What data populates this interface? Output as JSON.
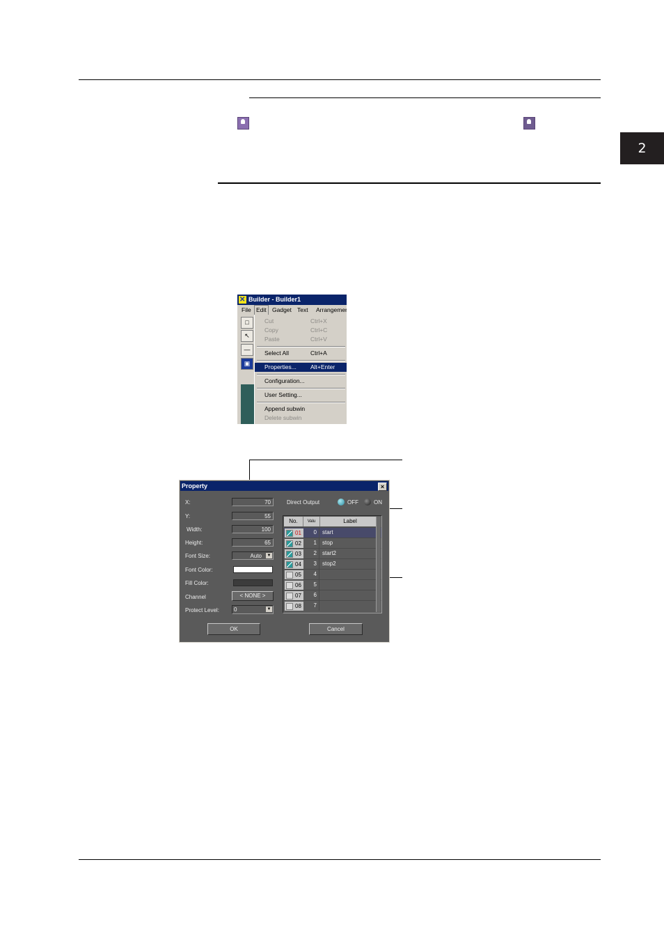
{
  "chapter_tab": "2",
  "menu": {
    "title": "Builder - Builder1",
    "menubar": [
      "File",
      "Edit",
      "Gadget",
      "Text",
      "Arrangemer"
    ],
    "items": [
      {
        "label": "Cut",
        "shortcut": "Ctrl+X",
        "disabled": true
      },
      {
        "label": "Copy",
        "shortcut": "Ctrl+C",
        "disabled": true
      },
      {
        "label": "Paste",
        "shortcut": "Ctrl+V",
        "disabled": true
      },
      {
        "label": "Select All",
        "shortcut": "Ctrl+A",
        "disabled": false
      },
      {
        "label": "Properties...",
        "shortcut": "Alt+Enter",
        "highlighted": true
      },
      {
        "label": "Configuration...",
        "shortcut": ""
      },
      {
        "label": "User Setting...",
        "shortcut": ""
      },
      {
        "label": "Append subwin",
        "shortcut": ""
      },
      {
        "label": "Delete subwin",
        "shortcut": "",
        "disabled": true
      }
    ]
  },
  "dialog": {
    "title": "Property",
    "close": "×",
    "fields": [
      {
        "label": "X:",
        "value": "70"
      },
      {
        "label": "Y:",
        "value": "55"
      },
      {
        "label": "Width:",
        "value": "100"
      },
      {
        "label": "Height:",
        "value": "65"
      },
      {
        "label": "Font Size:",
        "value": "Auto"
      },
      {
        "label": "Font Color:",
        "value": ""
      },
      {
        "label": "Fill Color:",
        "value": ""
      },
      {
        "label": "Channel",
        "value": "< NONE >"
      },
      {
        "label": "Protect Level:",
        "value": "0"
      }
    ],
    "font_color": "#ffffff",
    "fill_color": "#3c3c3c",
    "direct_output": {
      "label": "Direct Output",
      "off": "OFF",
      "on": "ON",
      "selected": "OFF"
    },
    "table": {
      "headers": [
        "No.",
        "Valu",
        "Label"
      ],
      "rows": [
        {
          "no": "01",
          "value": "0",
          "label": "start",
          "checked": true,
          "selected": true
        },
        {
          "no": "02",
          "value": "1",
          "label": "stop",
          "checked": true
        },
        {
          "no": "03",
          "value": "2",
          "label": "start2",
          "checked": true
        },
        {
          "no": "04",
          "value": "3",
          "label": "stop2",
          "checked": true
        },
        {
          "no": "05",
          "value": "4",
          "label": "",
          "checked": false
        },
        {
          "no": "06",
          "value": "5",
          "label": "",
          "checked": false
        },
        {
          "no": "07",
          "value": "6",
          "label": "",
          "checked": false
        },
        {
          "no": "08",
          "value": "7",
          "label": "",
          "checked": false
        }
      ]
    },
    "ok": "OK",
    "cancel": "Cancel"
  }
}
